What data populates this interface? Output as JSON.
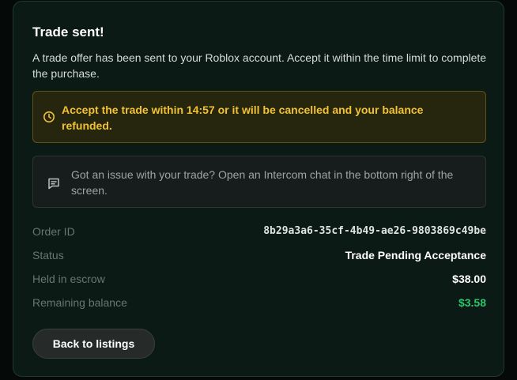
{
  "dialog": {
    "title": "Trade sent!",
    "description": "A trade offer has been sent to your Roblox account. Accept it within the time limit to complete the purchase."
  },
  "warning": {
    "icon": "clock-icon",
    "text": "Accept the trade within 14:57 or it will be cancelled and your balance refunded.",
    "color": "#f2c233"
  },
  "info": {
    "icon": "chat-icon",
    "text": "Got an issue with your trade? Open an Intercom chat in the bottom right of the screen."
  },
  "details": {
    "order_id": {
      "label": "Order ID",
      "value": "8b29a3a6-35cf-4b49-ae26-9803869c49be"
    },
    "status": {
      "label": "Status",
      "value": "Trade Pending Acceptance"
    },
    "escrow": {
      "label": "Held in escrow",
      "value": "$38.00"
    },
    "remaining": {
      "label": "Remaining balance",
      "value": "$3.58",
      "color": "#2ec46d"
    }
  },
  "actions": {
    "back_label": "Back to listings"
  }
}
